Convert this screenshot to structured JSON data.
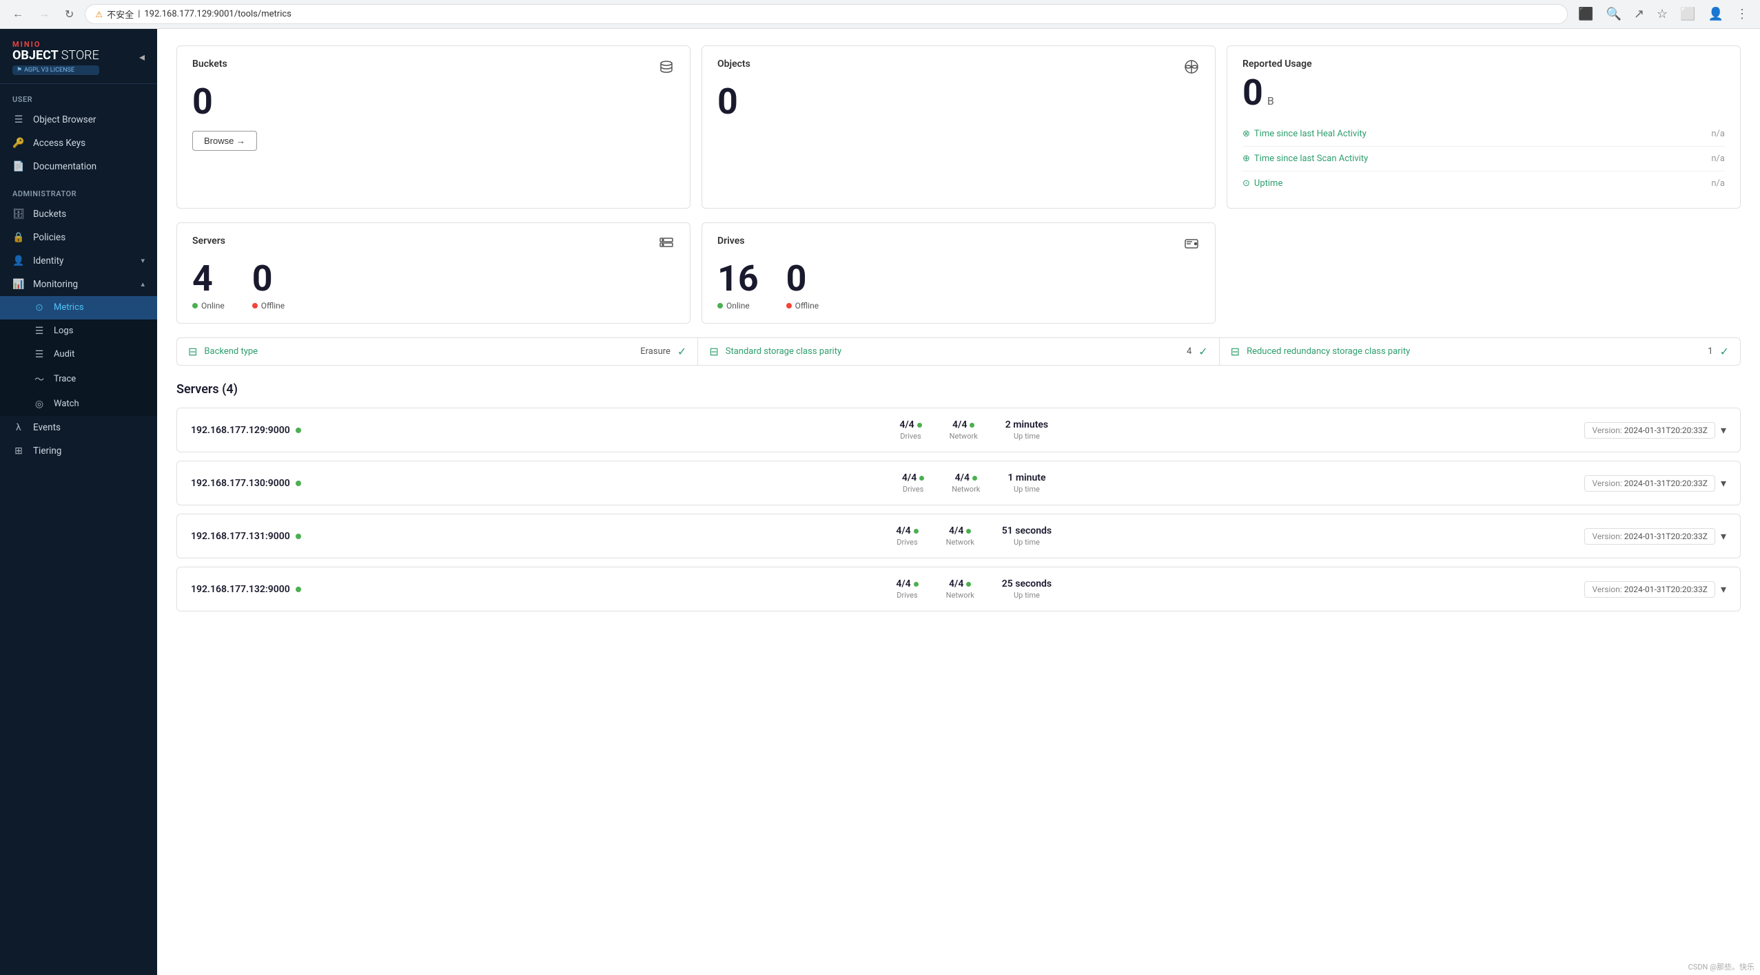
{
  "browser": {
    "back_disabled": false,
    "forward_disabled": false,
    "url": "192.168.177.129:9001/tools/metrics",
    "warning_text": "不安全",
    "favicon": "⚠"
  },
  "sidebar": {
    "logo": {
      "minio": "MINIO",
      "object_store": "OBJECT STORE",
      "license": "AGPL V3 LICENSE"
    },
    "user_section_label": "User",
    "user_items": [
      {
        "id": "object-browser",
        "icon": "☰",
        "label": "Object Browser"
      },
      {
        "id": "access-keys",
        "icon": "🔑",
        "label": "Access Keys"
      },
      {
        "id": "documentation",
        "icon": "📄",
        "label": "Documentation"
      }
    ],
    "admin_section_label": "Administrator",
    "admin_items": [
      {
        "id": "buckets",
        "icon": "🗄",
        "label": "Buckets"
      },
      {
        "id": "policies",
        "icon": "🔒",
        "label": "Policies"
      },
      {
        "id": "identity",
        "icon": "👤",
        "label": "Identity",
        "has_chevron": true
      },
      {
        "id": "monitoring",
        "icon": "📊",
        "label": "Monitoring",
        "has_chevron": true,
        "expanded": true
      },
      {
        "id": "metrics",
        "icon": "⊙",
        "label": "Metrics",
        "active": true,
        "sub": true
      },
      {
        "id": "logs",
        "icon": "☰",
        "label": "Logs",
        "sub": true
      },
      {
        "id": "audit",
        "icon": "☰",
        "label": "Audit",
        "sub": true
      },
      {
        "id": "trace",
        "icon": "〜",
        "label": "Trace",
        "sub": true
      },
      {
        "id": "watch",
        "icon": "◎",
        "label": "Watch",
        "sub": true
      },
      {
        "id": "events",
        "icon": "λ",
        "label": "Events"
      },
      {
        "id": "tiering",
        "icon": "⊞",
        "label": "Tiering"
      }
    ]
  },
  "stats": {
    "buckets": {
      "title": "Buckets",
      "value": "0",
      "browse_btn": "Browse →"
    },
    "objects": {
      "title": "Objects",
      "value": "0"
    },
    "reported_usage": {
      "title": "Reported Usage",
      "value": "0",
      "unit": "B",
      "rows": [
        {
          "icon": "⊗",
          "label": "Time since last Heal Activity",
          "value": "n/a"
        },
        {
          "icon": "⊕",
          "label": "Time since last Scan Activity",
          "value": "n/a"
        },
        {
          "icon": "⊙",
          "label": "Uptime",
          "value": "n/a"
        }
      ]
    },
    "servers": {
      "title": "Servers",
      "online": "4",
      "online_label": "Online",
      "offline": "0",
      "offline_label": "Offline"
    },
    "drives": {
      "title": "Drives",
      "online": "16",
      "online_label": "Online",
      "offline": "0",
      "offline_label": "Offline"
    }
  },
  "info_bar": [
    {
      "icon": "⊟",
      "label": "Backend type",
      "value": "Erasure",
      "check": "✓"
    },
    {
      "icon": "⊟",
      "label": "Standard storage class parity",
      "value": "4",
      "check": "✓"
    },
    {
      "icon": "⊟",
      "label": "Reduced redundancy storage class parity",
      "value": "1",
      "check": "✓"
    }
  ],
  "servers_section": {
    "title": "Servers (4)",
    "servers": [
      {
        "ip": "192.168.177.129:9000",
        "drives": "4/4",
        "drives_label": "Drives",
        "network": "4/4",
        "network_label": "Network",
        "uptime": "2 minutes",
        "uptime_label": "Up time",
        "version_label": "Version:",
        "version": "2024-01-31T20:20:33Z"
      },
      {
        "ip": "192.168.177.130:9000",
        "drives": "4/4",
        "drives_label": "Drives",
        "network": "4/4",
        "network_label": "Network",
        "uptime": "1 minute",
        "uptime_label": "Up time",
        "version_label": "Version:",
        "version": "2024-01-31T20:20:33Z"
      },
      {
        "ip": "192.168.177.131:9000",
        "drives": "4/4",
        "drives_label": "Drives",
        "network": "4/4",
        "network_label": "Network",
        "uptime": "51 seconds",
        "uptime_label": "Up time",
        "version_label": "Version:",
        "version": "2024-01-31T20:20:33Z"
      },
      {
        "ip": "192.168.177.132:9000",
        "drives": "4/4",
        "drives_label": "Drives",
        "network": "4/4",
        "network_label": "Network",
        "uptime": "25 seconds",
        "uptime_label": "Up time",
        "version_label": "Version:",
        "version": "2024-01-31T20:20:33Z"
      }
    ]
  },
  "watermark": "CSDN @那些。快乐"
}
